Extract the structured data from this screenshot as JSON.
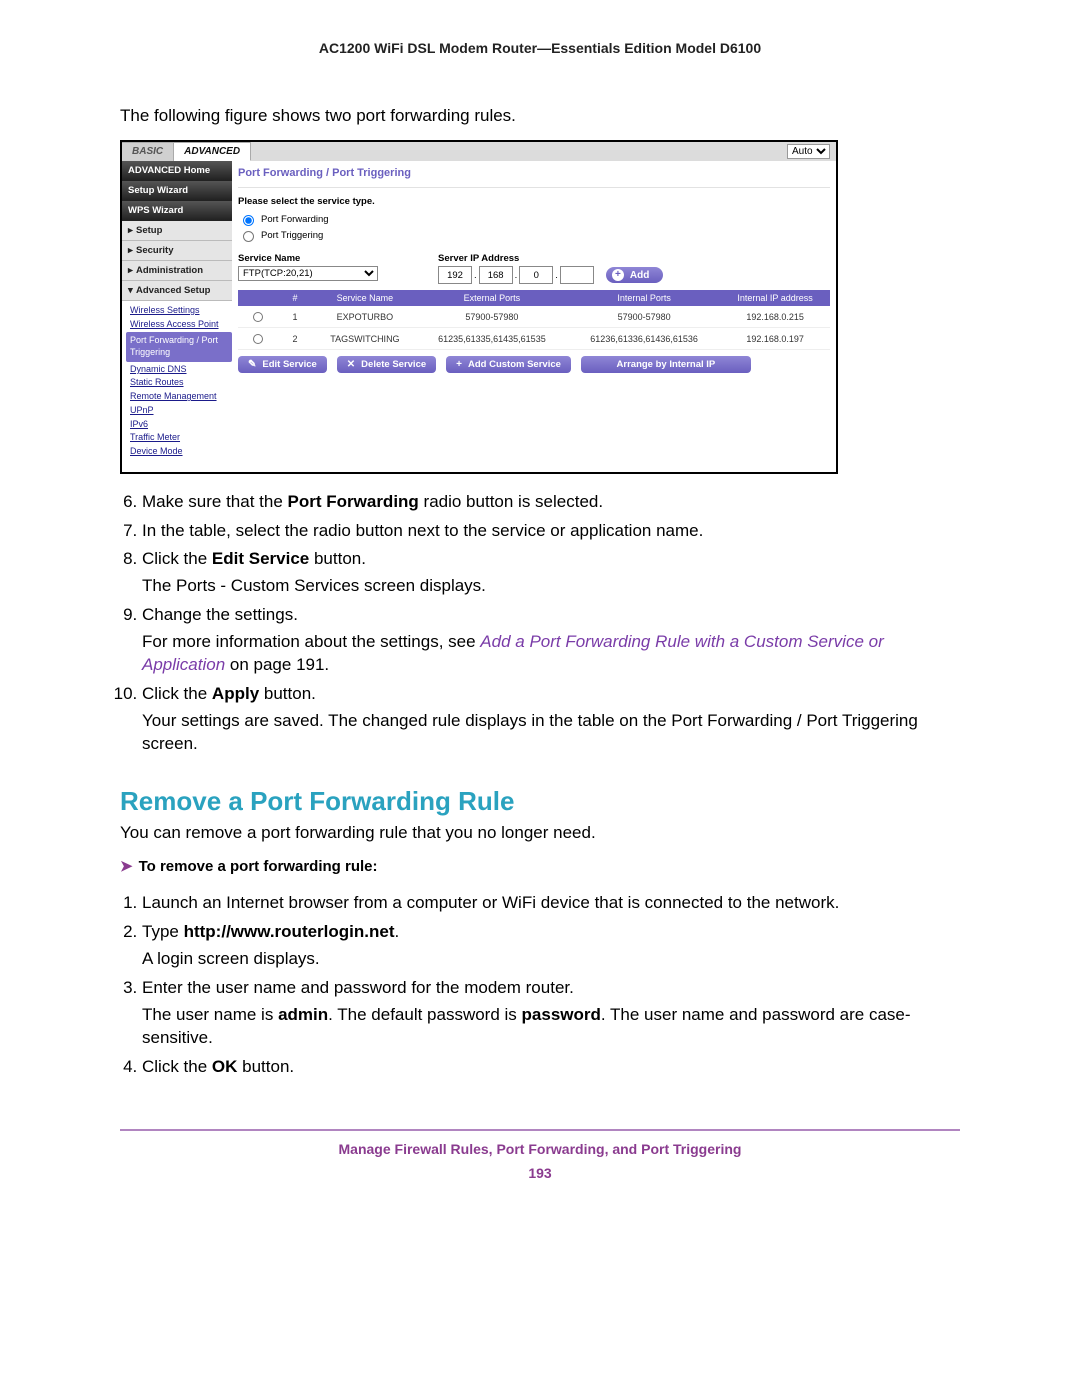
{
  "header": "AC1200 WiFi DSL Modem Router—Essentials Edition Model D6100",
  "intro": "The following figure shows two port forwarding rules.",
  "screenshot": {
    "tabs": {
      "basic": "BASIC",
      "advanced": "ADVANCED",
      "auto": "Auto"
    },
    "nav": {
      "home": "ADVANCED Home",
      "setup_wizard": "Setup Wizard",
      "wps_wizard": "WPS Wizard",
      "setup": "Setup",
      "security": "Security",
      "administration": "Administration",
      "advanced_setup": "Advanced Setup",
      "sub": {
        "wireless_settings": "Wireless Settings",
        "wireless_ap": "Wireless Access Point",
        "port_fwd": "Port Forwarding / Port Triggering",
        "ddns": "Dynamic DNS",
        "static_routes": "Static Routes",
        "remote_mgmt": "Remote Management",
        "upnp": "UPnP",
        "ipv6": "IPv6",
        "traffic_meter": "Traffic Meter",
        "device_mode": "Device Mode"
      }
    },
    "pane": {
      "title": "Port Forwarding / Port Triggering",
      "select_label": "Please select the service type.",
      "opt_forward": "Port Forwarding",
      "opt_trigger": "Port Triggering",
      "service_name_h": "Service Name",
      "service_name_val": "FTP(TCP:20,21)",
      "server_ip_h": "Server IP Address",
      "ip": {
        "a": "192",
        "b": "168",
        "c": "0",
        "d": ""
      },
      "add_btn": "Add",
      "table": {
        "headers": {
          "num": "#",
          "service": "Service Name",
          "ext": "External Ports",
          "int": "Internal Ports",
          "ip": "Internal IP address"
        },
        "rows": [
          {
            "num": "1",
            "service": "EXPOTURBO",
            "ext": "57900-57980",
            "int": "57900-57980",
            "ip": "192.168.0.215"
          },
          {
            "num": "2",
            "service": "TAGSWITCHING",
            "ext": "61235,61335,61435,61535",
            "int": "61236,61336,61436,61536",
            "ip": "192.168.0.197"
          }
        ]
      },
      "actions": {
        "edit": "Edit Service",
        "delete": "Delete Service",
        "add_custom": "Add Custom Service",
        "arrange": "Arrange by Internal IP"
      }
    }
  },
  "steps1": {
    "s6a": "Make sure that the ",
    "s6b": "Port Forwarding",
    "s6c": " radio button is selected.",
    "s7": "In the table, select the radio button next to the service or application name.",
    "s8a": "Click the ",
    "s8b": "Edit Service",
    "s8c": " button.",
    "s8_sub": "The Ports - Custom Services screen displays.",
    "s9": "Change the settings.",
    "s9_sub_a": "For more information about the settings, see ",
    "s9_sub_link": "Add a Port Forwarding Rule with a Custom Service or Application",
    "s9_sub_b": " on page 191.",
    "s10a": "Click the ",
    "s10b": "Apply",
    "s10c": " button.",
    "s10_sub": "Your settings are saved. The changed rule displays in the table on the Port Forwarding / Port Triggering screen."
  },
  "section2": {
    "title": "Remove a Port Forwarding Rule",
    "intro": "You can remove a port forwarding rule that you no longer need.",
    "to_head": "To remove a port forwarding rule:",
    "s1": "Launch an Internet browser from a computer or WiFi device that is connected to the network.",
    "s2a": "Type ",
    "s2b": "http://www.routerlogin.net",
    "s2c": ".",
    "s2_sub": "A login screen displays.",
    "s3": "Enter the user name and password for the modem router.",
    "s3_sub_a": "The user name is ",
    "s3_sub_b": "admin",
    "s3_sub_c": ". The default password is ",
    "s3_sub_d": "password",
    "s3_sub_e": ". The user name and password are case-sensitive.",
    "s4a": "Click the ",
    "s4b": "OK",
    "s4c": " button."
  },
  "footer": {
    "text": "Manage Firewall Rules, Port Forwarding, and Port Triggering",
    "num": "193"
  }
}
